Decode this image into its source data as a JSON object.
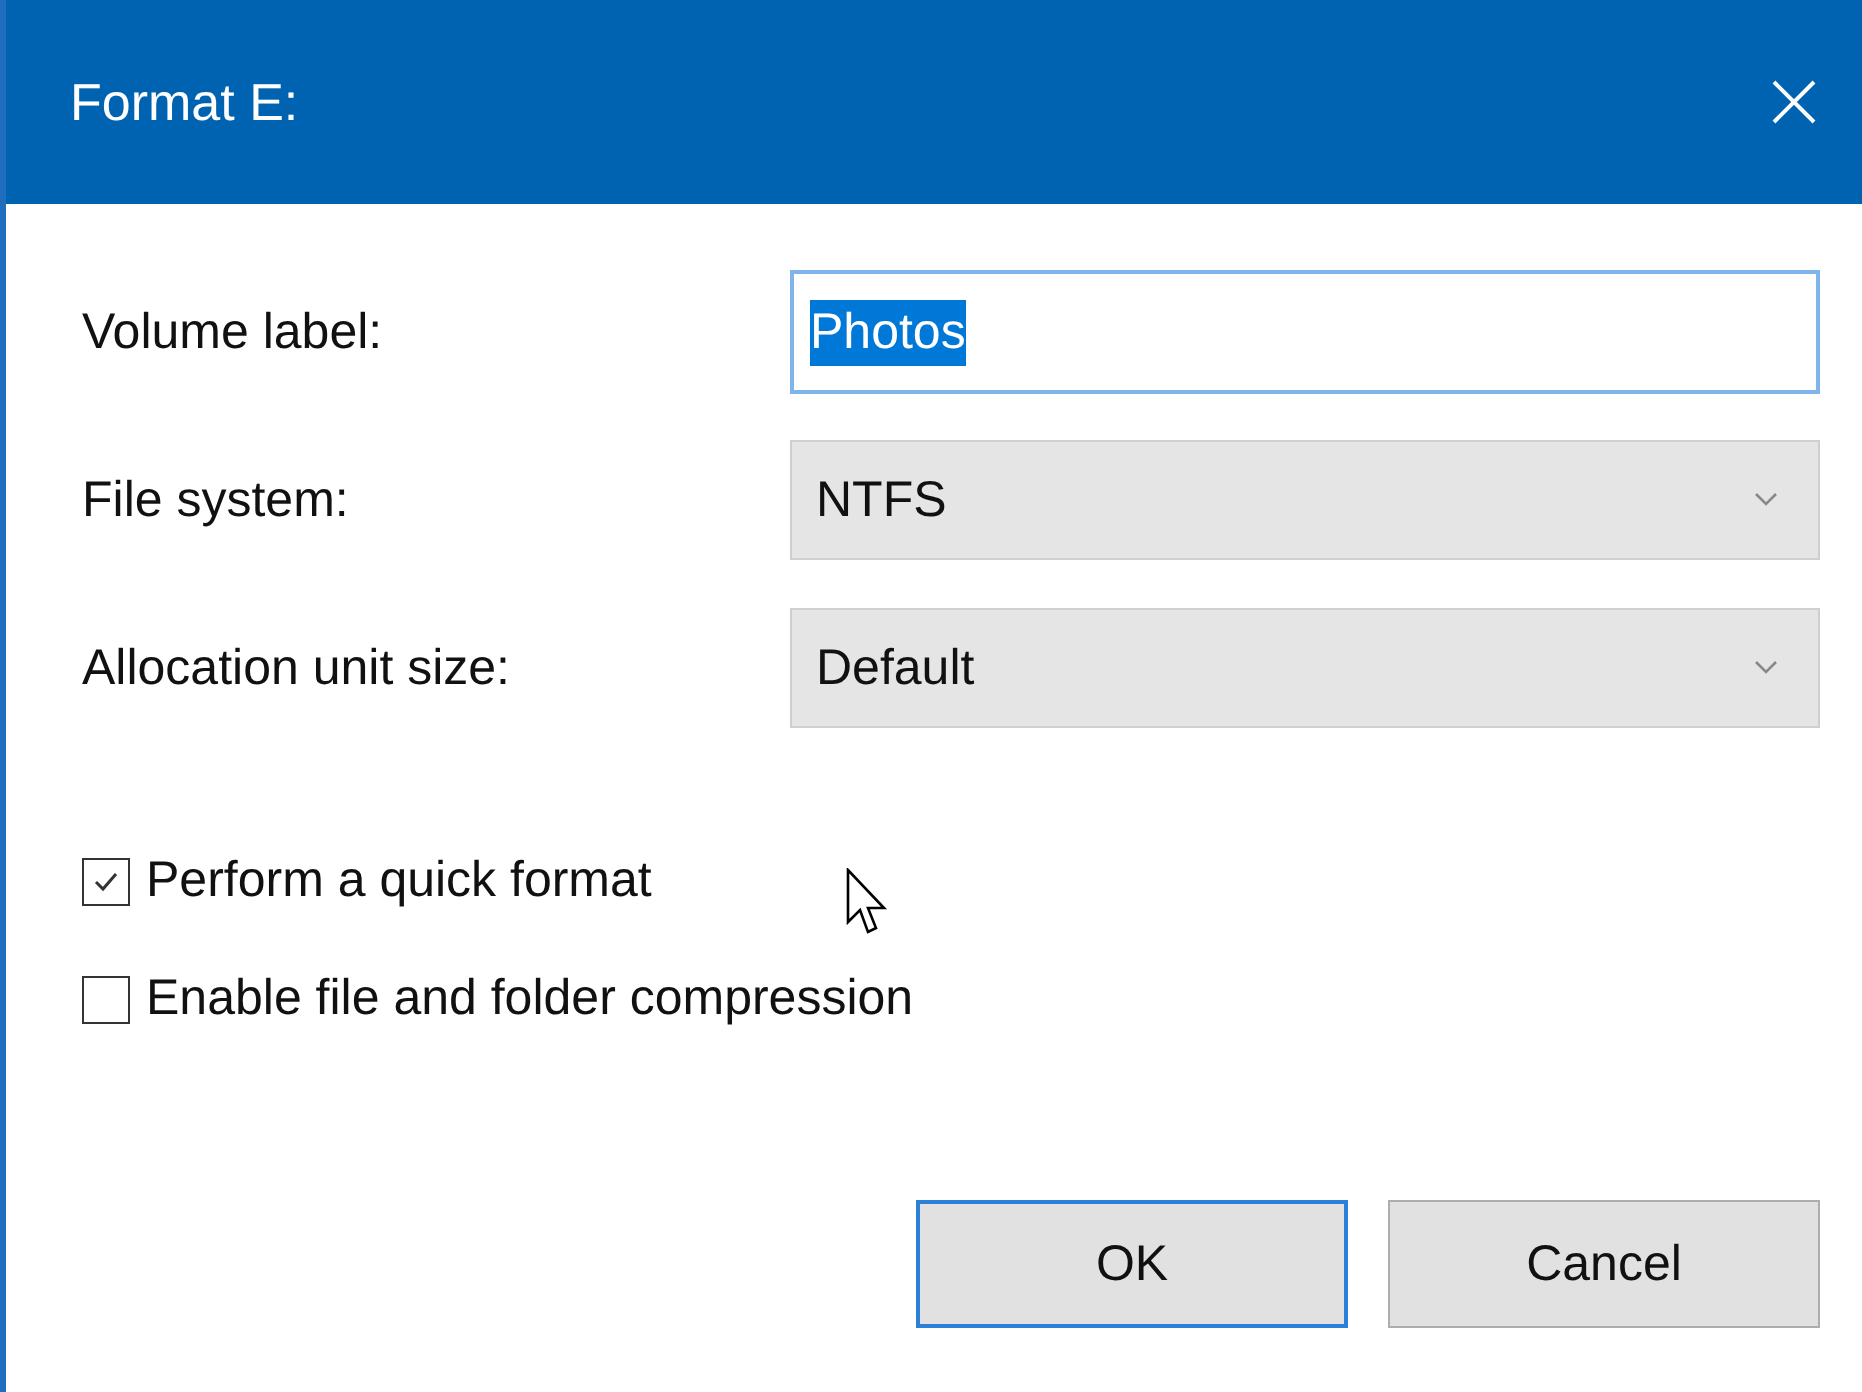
{
  "window": {
    "title": "Format E:"
  },
  "fields": [
    {
      "kind": "text",
      "label": "Volume label:",
      "value": "Photos",
      "selected": true
    },
    {
      "kind": "dropdown",
      "label": "File system:",
      "value": "NTFS"
    },
    {
      "kind": "dropdown",
      "label": "Allocation unit size:",
      "value": "Default"
    }
  ],
  "options": [
    {
      "label": "Perform a quick format",
      "checked": true
    },
    {
      "label": "Enable file and folder compression",
      "checked": false
    }
  ],
  "buttons": [
    {
      "label": "OK",
      "default": true
    },
    {
      "label": "Cancel",
      "default": false
    }
  ]
}
